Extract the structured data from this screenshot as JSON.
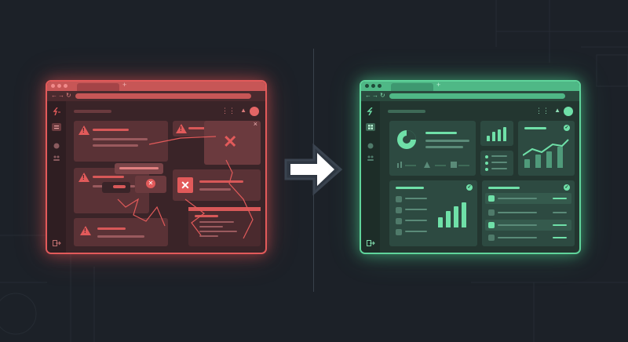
{
  "colors": {
    "background": "#1c2128",
    "broken_accent": "#e25a5a",
    "fixed_accent": "#5fd49b",
    "arrow": "#ffffff"
  },
  "broken_window": {
    "state": "error",
    "tab_plus": "+",
    "nav_back": "←",
    "nav_forward": "→",
    "nav_refresh": "↻",
    "grid_icon": "⋮⋮",
    "bell_icon": "🔔",
    "close_glyph": "×",
    "x_mark": "✕",
    "icons": [
      "logo-broken-icon",
      "menu-icon",
      "chat-icon",
      "users-icon",
      "logout-icon",
      "warning-icon",
      "error-x-icon"
    ]
  },
  "fixed_window": {
    "state": "healthy",
    "tab_plus": "+",
    "nav_back": "←",
    "nav_forward": "→",
    "nav_refresh": "↻",
    "grid_icon": "⋮⋮",
    "bell_icon": "🔔",
    "check_glyph": "✓",
    "icons": [
      "logo-icon",
      "dashboard-icon",
      "chat-icon",
      "users-icon",
      "logout-icon",
      "pie-chart-icon",
      "bar-chart-icon",
      "line-chart-icon",
      "check-icon"
    ],
    "bar_levels": [
      0.35,
      0.55,
      0.7,
      0.9
    ],
    "small_bar_levels": [
      0.4,
      0.65,
      0.85,
      1.0
    ]
  },
  "arrow": {
    "direction": "right",
    "icon": "arrow-right-icon"
  }
}
